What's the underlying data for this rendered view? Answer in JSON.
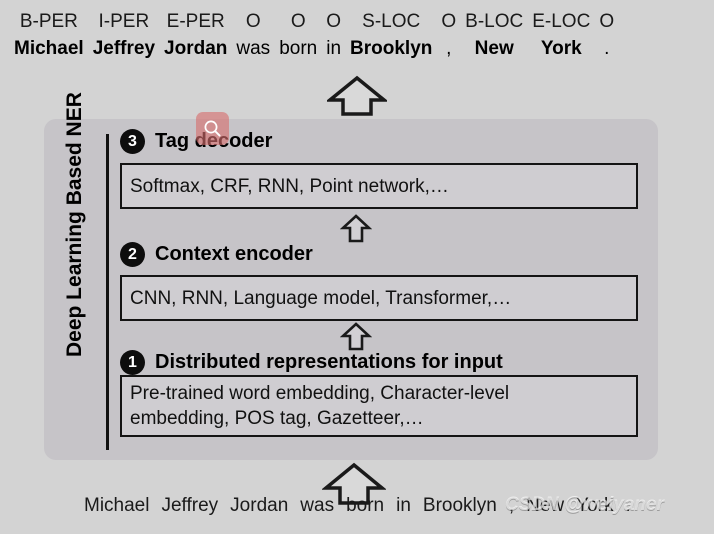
{
  "tagged_sentence": {
    "tokens": [
      {
        "tag": "B-PER",
        "word": "Michael",
        "bold": true
      },
      {
        "tag": "I-PER",
        "word": "Jeffrey",
        "bold": true
      },
      {
        "tag": "E-PER",
        "word": "Jordan",
        "bold": true
      },
      {
        "tag": "O",
        "word": "was",
        "bold": false
      },
      {
        "tag": "O",
        "word": "born",
        "bold": false
      },
      {
        "tag": "O",
        "word": "in",
        "bold": false
      },
      {
        "tag": "S-LOC",
        "word": "Brooklyn",
        "bold": true
      },
      {
        "tag": "O",
        "word": ",",
        "bold": false
      },
      {
        "tag": "B-LOC",
        "word": "New",
        "bold": true
      },
      {
        "tag": "E-LOC",
        "word": "York",
        "bold": true
      },
      {
        "tag": "O",
        "word": ".",
        "bold": false
      }
    ]
  },
  "panel": {
    "side_label": "Deep Learning Based NER",
    "stages": [
      {
        "number": "3",
        "title": "Tag decoder",
        "content": "Softmax, CRF, RNN, Point network,…"
      },
      {
        "number": "2",
        "title": "Context encoder",
        "content": "CNN, RNN, Language model, Transformer,…"
      },
      {
        "number": "1",
        "title": "Distributed representations for input",
        "content_line1": "Pre-trained word embedding, Character-level",
        "content_line2": "embedding, POS tag, Gazetteer,…"
      }
    ]
  },
  "input_sentence": {
    "words": [
      "Michael",
      "Jeffrey",
      "Jordan",
      "was",
      "born",
      "in",
      "Brooklyn",
      ",",
      "New",
      "York",
      "."
    ]
  },
  "overlay": {
    "cursor_icon": "magnifier-icon",
    "cursor_color": "#d66e6e"
  },
  "watermark": {
    "text": "CSDN @weiyaner"
  },
  "colors": {
    "page_background": "#d3d3d3",
    "panel_background": "#c6c4c8",
    "box_background": "#cfcdd1",
    "box_border": "#141414",
    "badge_background": "#0d0d0d"
  }
}
